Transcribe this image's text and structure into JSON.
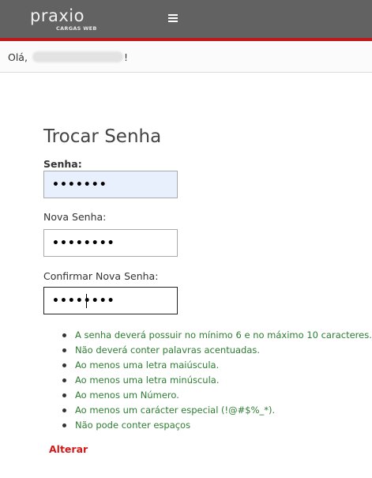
{
  "header": {
    "logo_text": "praxio",
    "logo_subtext": "CARGAS WEB",
    "menu_icon": "hamburger-menu-icon",
    "accent_color": "#c0191c",
    "bar_color": "#626262"
  },
  "greeting": {
    "prefix": "Olá,",
    "suffix": "!"
  },
  "form": {
    "title": "Trocar Senha",
    "senha_label": "Senha:",
    "senha_value": "•••••••",
    "nova_senha_label": "Nova Senha:",
    "nova_senha_value": "••••••••",
    "confirmar_label": "Confirmar Nova Senha:",
    "confirmar_value": "••••••••",
    "rules": [
      "A senha deverá possuir no mínimo 6 e no máximo 10 caracteres.",
      "Não deverá conter palavras acentuadas.",
      "Ao menos uma letra maiúscula.",
      "Ao menos uma letra minúscula.",
      "Ao menos um Número.",
      "Ao menos um carácter especial (!@#$%_*).",
      "Não pode conter espaços"
    ],
    "submit_label": "Alterar"
  }
}
